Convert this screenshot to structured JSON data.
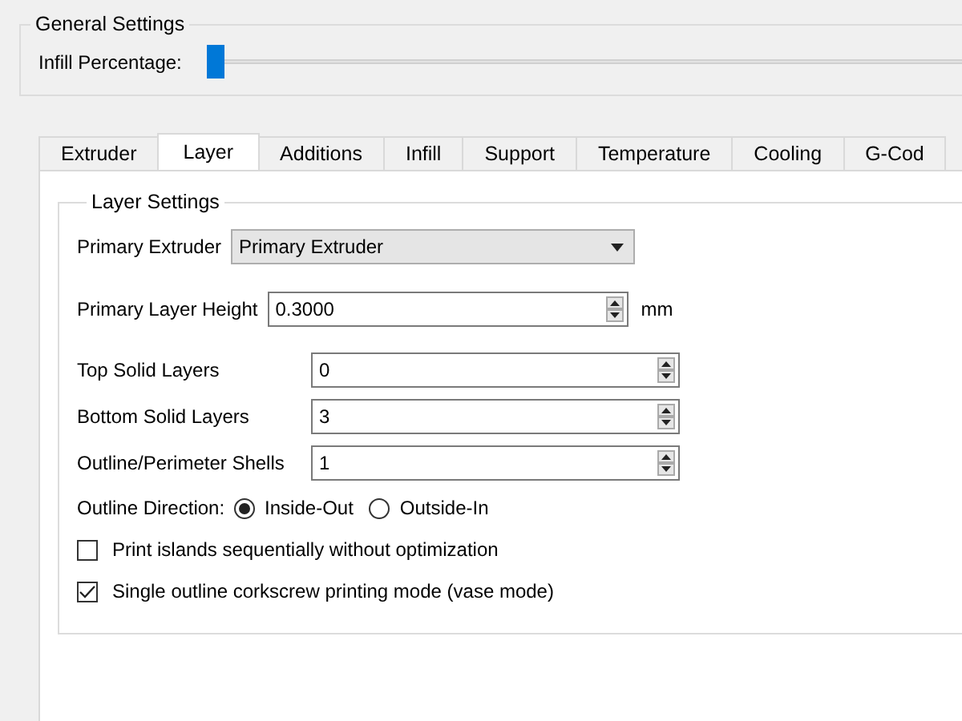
{
  "general": {
    "title": "General Settings",
    "infill_label": "Infill Percentage:",
    "level": 0
  },
  "tabs": [
    {
      "label": "Extruder",
      "selected": false
    },
    {
      "label": "Layer",
      "selected": true
    },
    {
      "label": "Additions",
      "selected": false
    },
    {
      "label": "Infill",
      "selected": false
    },
    {
      "label": "Support",
      "selected": false
    },
    {
      "label": "Temperature",
      "selected": false
    },
    {
      "label": "Cooling",
      "selected": false
    },
    {
      "label": "G-Cod",
      "selected": false
    }
  ],
  "layer_settings": {
    "title": "Layer Settings",
    "fields": [
      {
        "kind": "dropdown",
        "label": "Primary Extruder",
        "value": "Primary Extruder"
      },
      {
        "kind": "spin-wide",
        "label": "Primary Layer Height",
        "value": "0.3000",
        "unit": "mm"
      },
      {
        "kind": "spin",
        "label": "Top Solid Layers",
        "value": "0"
      },
      {
        "kind": "spin",
        "label": "Bottom Solid Layers",
        "value": "3"
      },
      {
        "kind": "spin",
        "label": "Outline/Perimeter Shells",
        "value": "1"
      }
    ],
    "outline_direction": {
      "label": "Outline Direction:",
      "options": [
        {
          "label": "Inside-Out",
          "selected": true
        },
        {
          "label": "Outside-In",
          "selected": false
        }
      ]
    },
    "checkboxes": [
      {
        "label": "Print islands sequentially without optimization",
        "checked": false
      },
      {
        "label": "Single outline corkscrew printing mode (vase mode)",
        "checked": true
      }
    ]
  }
}
